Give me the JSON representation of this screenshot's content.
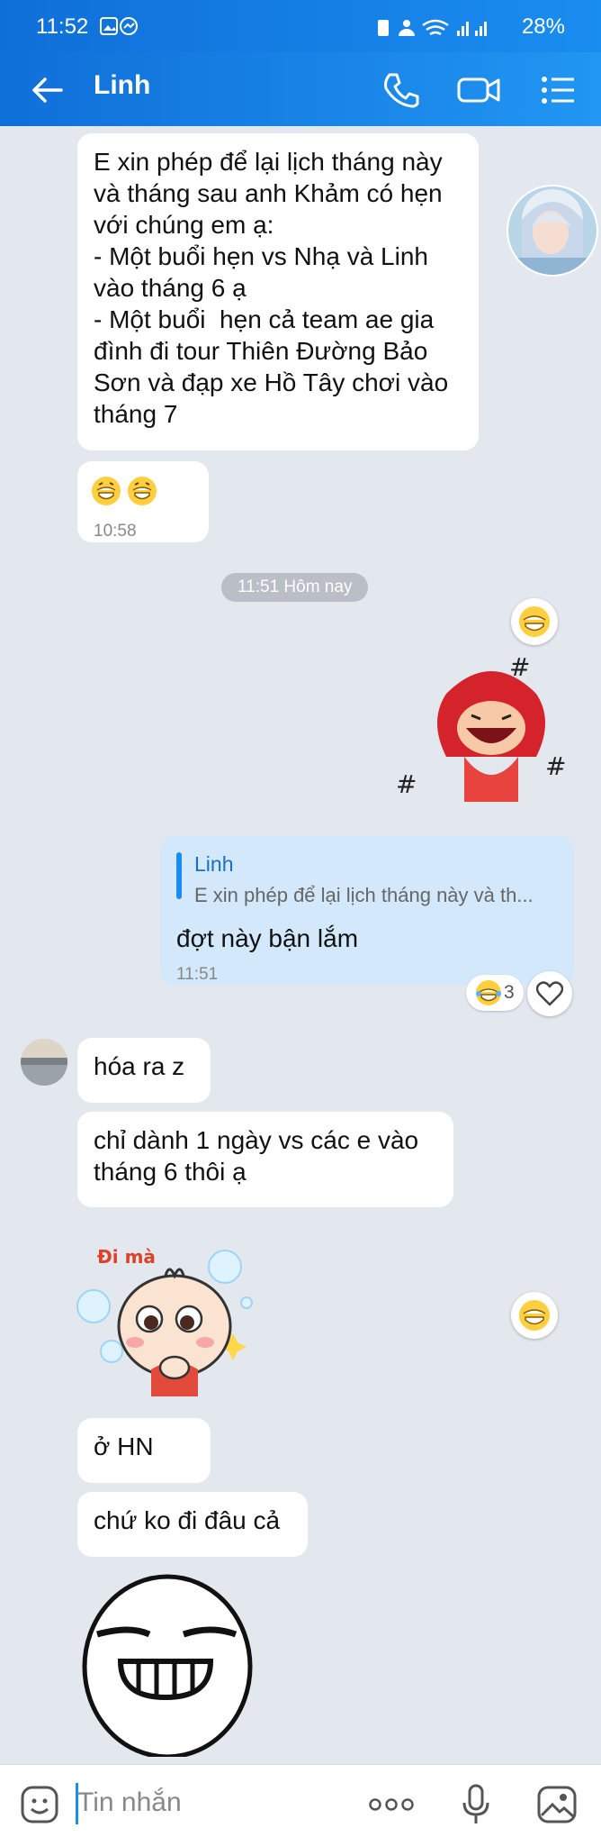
{
  "status_bar": {
    "time": "11:52",
    "battery": "28%"
  },
  "header": {
    "title": "Linh"
  },
  "messages": {
    "m1": "E xin phép để lại lịch tháng này và tháng sau anh Khảm có hẹn với chúng em ạ:\n- Một buổi hẹn vs Nhạ và Linh vào tháng 6 ạ\n- Một buổi  hẹn cả team ae gia đình đi tour Thiên Đường Bảo Sơn và đạp xe Hồ Tây chơi vào tháng 7",
    "m2_time": "10:58",
    "divider": "11:51 Hôm nay",
    "reply_name": "Linh",
    "reply_quote": "E xin phép để lại lịch tháng này và th...",
    "reply_text": "đợt này bận lắm",
    "reply_time": "11:51",
    "reaction_count": "3",
    "m4": "hóa ra z",
    "m5": "chỉ dành 1 ngày vs các e vào tháng 6 thôi ạ",
    "m6": "ở HN",
    "m7": "chứ ko đi đâu cả",
    "sticker_text": "Đi mà"
  },
  "composer": {
    "placeholder": "Tin nhắn"
  },
  "colors": {
    "header": "#1a8df0",
    "my_bubble": "#d3e9fb",
    "bg": "#e3e7ee"
  }
}
